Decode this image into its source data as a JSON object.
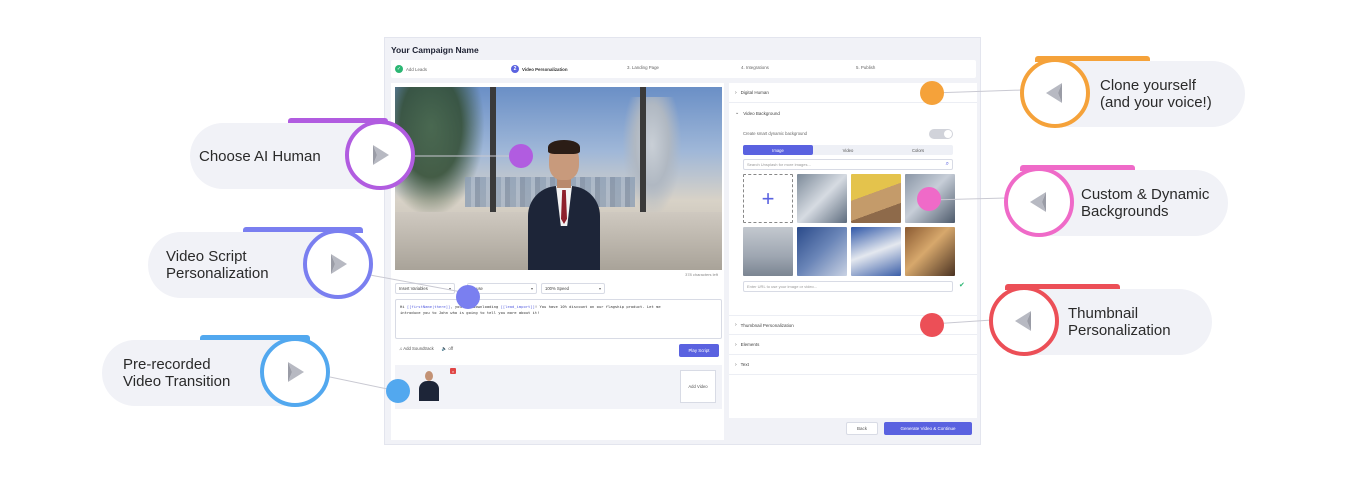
{
  "app": {
    "title": "Your Campaign Name",
    "steps": [
      {
        "label": "Add Leads",
        "marker": "✓"
      },
      {
        "label": "Video Personalization",
        "marker": "2"
      },
      {
        "label": "3. Landing Page"
      },
      {
        "label": "4. Integrations"
      },
      {
        "label": "5. Publish"
      }
    ],
    "video": {
      "chars_left": "378 characters left"
    },
    "controls": {
      "insert_variables": "Insert Variables",
      "pause": "Pause",
      "speed": "100% Speed"
    },
    "script": {
      "line1_pre": "Hi ",
      "var1": "[[firstName|there]]",
      "line1_mid": ", you for downloading ",
      "var2": "[[lead_import]]",
      "line1_post": "! You have 10% discount on our flagship product. Let me",
      "line2": "introduce you to John who is going to tell you more about it!"
    },
    "soundtrack": {
      "add": "Add Soundtrack",
      "toggle": "off"
    },
    "play_script": "Play Script",
    "add_video": "Add Video",
    "right_panel": {
      "digital_human": "Digital Human",
      "video_background": "Video Background",
      "dynamic_toggle_label": "Create smart dynamic background",
      "tabs": [
        "Image",
        "Video",
        "Colors"
      ],
      "search_placeholder": "Search Unsplash for more images...",
      "url_placeholder": "Enter URL to use your image or video...",
      "thumbnail_personalization": "Thumbnail Personalization",
      "elements": "Elements",
      "text": "Text"
    },
    "footer": {
      "back": "Back",
      "generate": "Generate Video & Continue"
    }
  },
  "callouts": {
    "choose_ai_human": "Choose AI Human",
    "video_script": "Video Script\nPersonalization",
    "pre_recorded": "Pre-recorded\nVideo Transition",
    "clone_yourself": "Clone yourself\n(and your voice!)",
    "custom_backgrounds": "Custom & Dynamic\nBackgrounds",
    "thumbnail": "Thumbnail\nPersonalization"
  },
  "colors": {
    "accent": "#5a62e0",
    "purple": "#b15ce0",
    "indigo": "#7a7ff0",
    "blue": "#52a8ef",
    "orange": "#f5a23a",
    "pink": "#ef6ac8",
    "red": "#ec4f57"
  }
}
